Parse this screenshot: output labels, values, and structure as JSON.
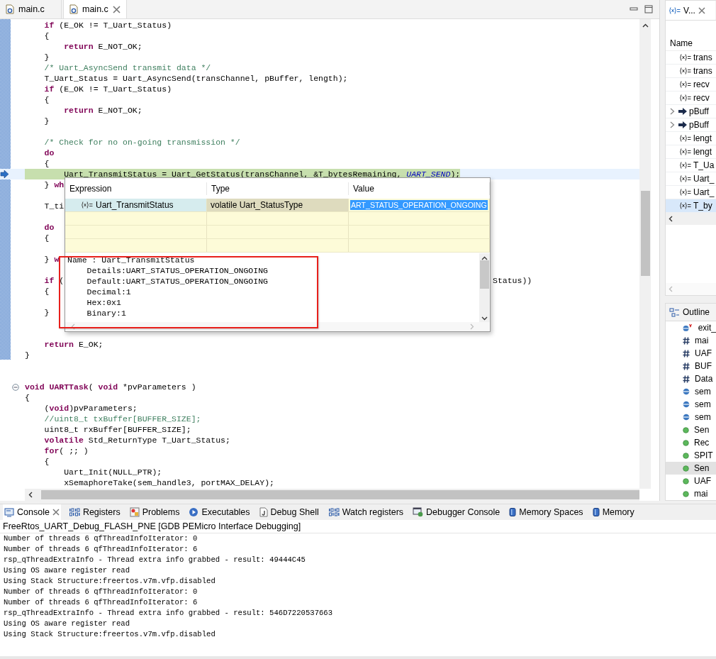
{
  "editor": {
    "tabs": [
      {
        "label": "main.c",
        "selected": false,
        "closable": false
      },
      {
        "label": "main.c",
        "selected": true,
        "closable": true
      }
    ],
    "lines": [
      {
        "kind": "code",
        "text": "    **if** (E_OK != T_Uart_Status)",
        "current": false
      },
      {
        "kind": "code",
        "text": "    {",
        "current": false
      },
      {
        "kind": "code",
        "text": "        **return** E_NOT_OK;",
        "current": false
      },
      {
        "kind": "code",
        "text": "    }",
        "current": false
      },
      {
        "kind": "comment",
        "text": "    /* Uart_AsyncSend transmit data */",
        "current": false
      },
      {
        "kind": "code",
        "text": "    T_Uart_Status = Uart_AsyncSend(transChannel, pBuffer, length);",
        "current": false
      },
      {
        "kind": "code",
        "text": "    **if** (E_OK != T_Uart_Status)",
        "current": false
      },
      {
        "kind": "code",
        "text": "    {",
        "current": false
      },
      {
        "kind": "code",
        "text": "        **return** E_NOT_OK;",
        "current": false
      },
      {
        "kind": "code",
        "text": "    }",
        "current": false
      },
      {
        "kind": "blank",
        "current": false
      },
      {
        "kind": "comment",
        "text": "    /* Check for no on-going transmission */",
        "current": false
      },
      {
        "kind": "code",
        "text": "    **do**",
        "current": false
      },
      {
        "kind": "code",
        "text": "    {",
        "current": false
      },
      {
        "kind": "code",
        "text": "        Uart_TransmitStatus = Uart_GetStatus(transChannel, &T_bytesRemaining, *UART_SEND*);",
        "current": true
      },
      {
        "kind": "code",
        "text": "    } **wh**",
        "current": false
      },
      {
        "kind": "blank",
        "current": false
      },
      {
        "kind": "code",
        "text": "    T_ti",
        "current": false
      },
      {
        "kind": "blank",
        "current": false
      },
      {
        "kind": "code",
        "text": "    **do**",
        "current": false
      },
      {
        "kind": "code",
        "text": "    {",
        "current": false
      },
      {
        "kind": "blank",
        "current": false
      },
      {
        "kind": "code",
        "text": "    } **w**",
        "current": false
      },
      {
        "kind": "blank",
        "current": false
      },
      {
        "kind": "code",
        "text": "    **if** (",
        "tail": "Status))",
        "current": false
      },
      {
        "kind": "code",
        "text": "    {",
        "current": false
      },
      {
        "kind": "blank",
        "current": false
      },
      {
        "kind": "code",
        "text": "    }",
        "current": false
      },
      {
        "kind": "blank",
        "current": false
      },
      {
        "kind": "blank",
        "current": false
      },
      {
        "kind": "code",
        "text": "    **return** E_OK;",
        "current": false
      },
      {
        "kind": "code",
        "text": "}",
        "current": false
      },
      {
        "kind": "blank",
        "current": false
      },
      {
        "kind": "blank",
        "current": false
      },
      {
        "kind": "fold",
        "text": "**void** **UARTTask**( **void** *pvParameters )",
        "current": false
      },
      {
        "kind": "code",
        "text": "{",
        "current": false
      },
      {
        "kind": "code",
        "text": "    (**void**)pvParameters;",
        "current": false
      },
      {
        "kind": "comment",
        "text": "    //uint8_t txBuffer[BUFFER_SIZE];",
        "current": false
      },
      {
        "kind": "code",
        "text": "    uint8_t rxBuffer[BUFFER_SIZE];",
        "current": false
      },
      {
        "kind": "code",
        "text": "    **volatile** Std_ReturnType T_Uart_Status;",
        "current": false
      },
      {
        "kind": "code",
        "text": "    **for**( ;; )",
        "current": false
      },
      {
        "kind": "code",
        "text": "    {",
        "current": false
      },
      {
        "kind": "code",
        "text": "        Uart_Init(NULL_PTR);",
        "current": false
      },
      {
        "kind": "code",
        "text": "        xSemaphoreTake(sem_handle3, portMAX_DELAY);",
        "current": false
      }
    ],
    "hover": {
      "columns": [
        "Expression",
        "Type",
        "Value"
      ],
      "rows": [
        {
          "expression": "Uart_TransmitStatus",
          "type": "volatile Uart_StatusType",
          "value": "ART_STATUS_OPERATION_ONGOING",
          "selected": true
        }
      ],
      "details": [
        "Name : Uart_TransmitStatus",
        "    Details:UART_STATUS_OPERATION_ONGOING",
        "    Default:UART_STATUS_OPERATION_ONGOING",
        "    Decimal:1",
        "    Hex:0x1",
        "    Binary:1"
      ]
    }
  },
  "variables": {
    "tab": "V...",
    "column": "Name",
    "items": [
      {
        "name": "trans",
        "kind": "variable",
        "selected": false
      },
      {
        "name": "trans",
        "kind": "variable",
        "selected": false
      },
      {
        "name": "recv",
        "kind": "variable",
        "selected": false
      },
      {
        "name": "recv",
        "kind": "variable",
        "selected": false
      },
      {
        "name": "pBuff",
        "kind": "pointer",
        "selected": false
      },
      {
        "name": "pBuff",
        "kind": "pointer",
        "selected": false
      },
      {
        "name": "lengt",
        "kind": "variable",
        "selected": false
      },
      {
        "name": "lengt",
        "kind": "variable",
        "selected": false
      },
      {
        "name": "T_Ua",
        "kind": "variable",
        "selected": false
      },
      {
        "name": "Uart_",
        "kind": "variable",
        "selected": false
      },
      {
        "name": "Uart_",
        "kind": "variable",
        "selected": false
      },
      {
        "name": "T_by",
        "kind": "variable",
        "selected": true
      }
    ]
  },
  "outline": {
    "title": "Outline",
    "items": [
      {
        "name": "exit_",
        "kind": "volatile",
        "selected": false
      },
      {
        "name": "mai",
        "kind": "macro",
        "selected": false
      },
      {
        "name": "UAF",
        "kind": "macro",
        "selected": false
      },
      {
        "name": "BUF",
        "kind": "macro",
        "selected": false
      },
      {
        "name": "Data",
        "kind": "macro",
        "selected": false
      },
      {
        "name": "sem",
        "kind": "variable",
        "selected": false
      },
      {
        "name": "sem",
        "kind": "variable",
        "selected": false
      },
      {
        "name": "sem",
        "kind": "variable",
        "selected": false
      },
      {
        "name": "Sen",
        "kind": "function",
        "selected": false
      },
      {
        "name": "Rec",
        "kind": "function",
        "selected": false
      },
      {
        "name": "SPIT",
        "kind": "function",
        "selected": false
      },
      {
        "name": "Sen",
        "kind": "function",
        "selected": true
      },
      {
        "name": "UAF",
        "kind": "function",
        "selected": false
      },
      {
        "name": "mai",
        "kind": "function",
        "selected": false
      }
    ]
  },
  "console": {
    "tabs": [
      {
        "label": "Console",
        "kind": "console",
        "selected": true,
        "closable": true
      },
      {
        "label": "Registers",
        "kind": "binary",
        "selected": false,
        "closable": false
      },
      {
        "label": "Problems",
        "kind": "problems",
        "selected": false,
        "closable": false
      },
      {
        "label": "Executables",
        "kind": "executables",
        "selected": false,
        "closable": false
      },
      {
        "label": "Debug Shell",
        "kind": "shell",
        "selected": false,
        "closable": false
      },
      {
        "label": "Watch registers",
        "kind": "binary",
        "selected": false,
        "closable": false
      },
      {
        "label": "Debugger Console",
        "kind": "debugger",
        "selected": false,
        "closable": false
      },
      {
        "label": "Memory Spaces",
        "kind": "memory",
        "selected": false,
        "closable": false
      },
      {
        "label": "Memory",
        "kind": "memory",
        "selected": false,
        "closable": false
      }
    ],
    "session": "FreeRtos_UART_Debug_FLASH_PNE [GDB PEMicro Interface Debugging]",
    "lines": [
      "Number of threads 6 qfThreadInfoIterator: 0",
      "Number of threads 6 qfThreadInfoIterator: 6",
      "rsp_qThreadExtraInfo - Thread extra info grabbed - result: 49444C45",
      "Using OS aware register read",
      "Using Stack Structure:freertos.v7m.vfp.disabled",
      "Number of threads 6 qfThreadInfoIterator: 0",
      "Number of threads 6 qfThreadInfoIterator: 6",
      "rsp_qThreadExtraInfo - Thread extra info grabbed - result: 546D7220537663",
      "Using OS aware register read",
      "Using Stack Structure:freertos.v7m.vfp.disabled"
    ]
  }
}
